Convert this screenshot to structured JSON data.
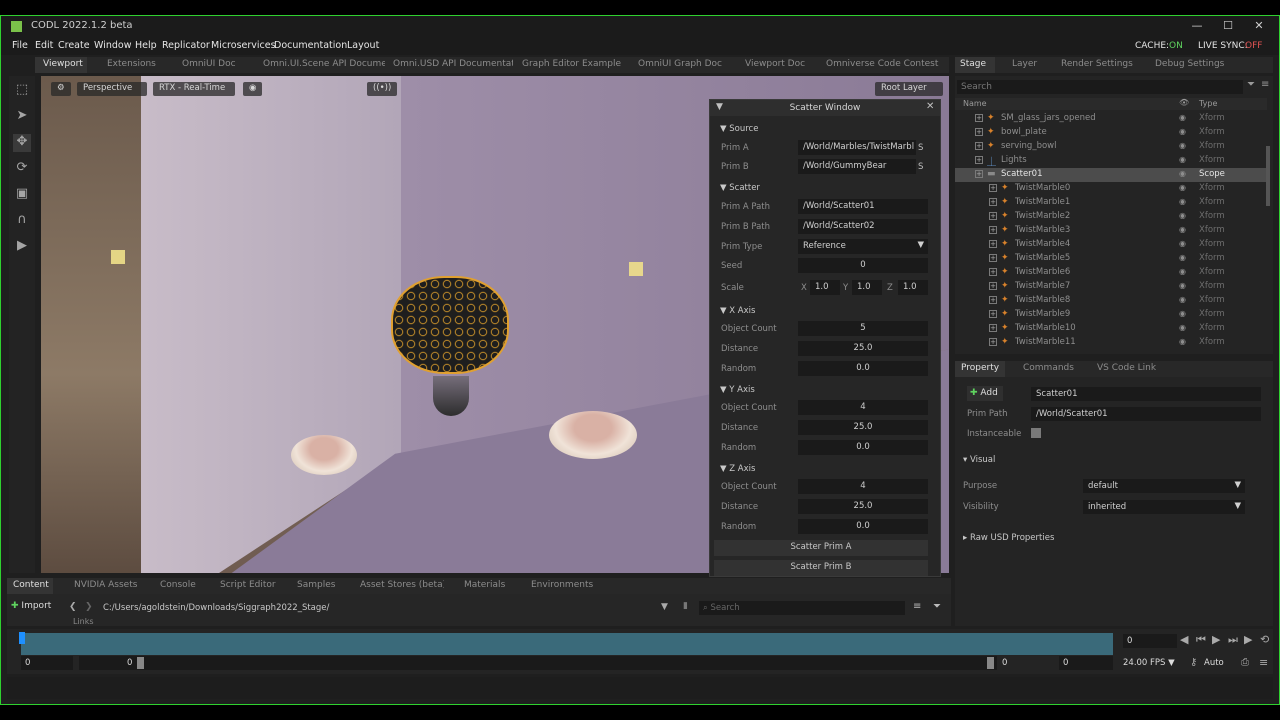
{
  "app": {
    "title": "CODL  2022.1.2 beta"
  },
  "menu": [
    "File",
    "Edit",
    "Create",
    "Window",
    "Help",
    "Replicator",
    "Microservices",
    "Documentation",
    "Layout"
  ],
  "cache": {
    "label": "CACHE:",
    "value": "ON"
  },
  "livesync": {
    "label": "LIVE SYNC:",
    "value": "OFF"
  },
  "top_tabs": [
    "Viewport",
    "Extensions",
    "OmniUI Doc",
    "Omni.UI.Scene API Docume...",
    "Omni.USD API Documentat...",
    "Graph Editor Example",
    "OmniUI Graph Doc",
    "Viewport Doc",
    "Omniverse Code Contest"
  ],
  "stage_tabs": [
    "Stage",
    "Layer",
    "Render Settings",
    "Debug Settings"
  ],
  "viewport": {
    "perspective": "Perspective",
    "rtx": "RTX - Real-Time",
    "root_layer": "Root Layer"
  },
  "scatter": {
    "title": "Scatter Window",
    "source_label": "Source",
    "prim_a_label": "Prim A",
    "prim_a_value": "/World/Marbles/TwistMarbl",
    "prim_b_label": "Prim B",
    "prim_b_value": "/World/GummyBear",
    "s_label": "S",
    "scatter_label": "Scatter",
    "prim_a_path_label": "Prim A Path",
    "prim_a_path_value": "/World/Scatter01",
    "prim_b_path_label": "Prim B Path",
    "prim_b_path_value": "/World/Scatter02",
    "prim_type_label": "Prim Type",
    "prim_type_value": "Reference",
    "seed_label": "Seed",
    "seed_value": "0",
    "scale_label": "Scale",
    "scale_x": "1.0",
    "scale_y": "1.0",
    "scale_z": "1.0",
    "x_axis": {
      "label": "X Axis",
      "count": "5",
      "distance": "25.0",
      "random": "0.0"
    },
    "y_axis": {
      "label": "Y Axis",
      "count": "4",
      "distance": "25.0",
      "random": "0.0"
    },
    "z_axis": {
      "label": "Z Axis",
      "count": "4",
      "distance": "25.0",
      "random": "0.0"
    },
    "object_count_label": "Object Count",
    "distance_label": "Distance",
    "random_label": "Random",
    "btn_a": "Scatter Prim A",
    "btn_b": "Scatter Prim B"
  },
  "stage": {
    "search_placeholder": "Search",
    "col_name": "Name",
    "col_type": "Type",
    "rows": [
      {
        "name": "SM_glass_jars_opened",
        "type": "Xform"
      },
      {
        "name": "bowl_plate",
        "type": "Xform"
      },
      {
        "name": "serving_bowl",
        "type": "Xform"
      },
      {
        "name": "Lights",
        "type": "Xform"
      },
      {
        "name": "Scatter01",
        "type": "Scope"
      },
      {
        "name": "TwistMarble0",
        "type": "Xform"
      },
      {
        "name": "TwistMarble1",
        "type": "Xform"
      },
      {
        "name": "TwistMarble2",
        "type": "Xform"
      },
      {
        "name": "TwistMarble3",
        "type": "Xform"
      },
      {
        "name": "TwistMarble4",
        "type": "Xform"
      },
      {
        "name": "TwistMarble5",
        "type": "Xform"
      },
      {
        "name": "TwistMarble6",
        "type": "Xform"
      },
      {
        "name": "TwistMarble7",
        "type": "Xform"
      },
      {
        "name": "TwistMarble8",
        "type": "Xform"
      },
      {
        "name": "TwistMarble9",
        "type": "Xform"
      },
      {
        "name": "TwistMarble10",
        "type": "Xform"
      },
      {
        "name": "TwistMarble11",
        "type": "Xform"
      }
    ]
  },
  "property": {
    "tabs": [
      "Property",
      "Commands",
      "VS Code Link"
    ],
    "add": "Add",
    "prim_name": "Scatter01",
    "prim_path_label": "Prim Path",
    "prim_path": "/World/Scatter01",
    "instanceable_label": "Instanceable",
    "visual_label": "Visual",
    "purpose_label": "Purpose",
    "purpose_value": "default",
    "visibility_label": "Visibility",
    "visibility_value": "inherited",
    "raw_label": "Raw USD Properties"
  },
  "content": {
    "tabs": [
      "Content",
      "NVIDIA Assets",
      "Console",
      "Script Editor",
      "Samples",
      "Asset Stores (beta)",
      "Materials",
      "Environments"
    ],
    "import": "Import",
    "path": "C:/Users/agoldstein/Downloads/Siggraph2022_Stage/",
    "search_placeholder": "Search",
    "partial_item": "Links"
  },
  "timeline": {
    "frame_value": "0",
    "start": "0",
    "cur": "0",
    "end": "0",
    "end2": "0",
    "fps": "24.00 FPS",
    "auto": "Auto"
  }
}
